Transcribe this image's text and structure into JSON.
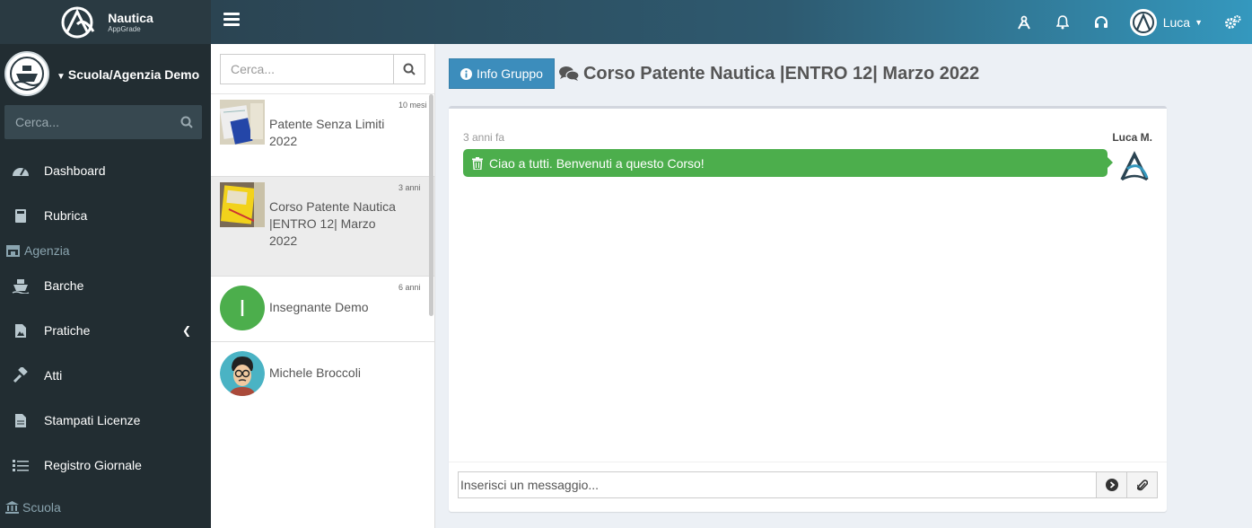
{
  "brand": {
    "name": "Nautica",
    "sub": "AppGrade"
  },
  "sidebar": {
    "user_name": "Scuola/Agenzia Demo",
    "search_placeholder": "Cerca...",
    "items": [
      {
        "label": "Dashboard",
        "icon": "dashboard-icon"
      },
      {
        "label": "Rubrica",
        "icon": "book-icon"
      },
      {
        "header": "Agenzia",
        "icon": "store-icon"
      },
      {
        "label": "Barche",
        "icon": "ship-icon"
      },
      {
        "label": "Pratiche",
        "icon": "file-image-icon",
        "has_submenu": true
      },
      {
        "label": "Atti",
        "icon": "gavel-icon"
      },
      {
        "label": "Stampati Licenze",
        "icon": "file-text-icon"
      },
      {
        "label": "Registro Giornale",
        "icon": "list-icon"
      },
      {
        "header": "Scuola",
        "icon": "institution-icon"
      }
    ]
  },
  "topbar": {
    "user_label": "Luca"
  },
  "chatlist": {
    "search_placeholder": "Cerca...",
    "conversations": [
      {
        "name": "Patente Senza Limiti 2022",
        "time": "10 mesi",
        "avatar": "photo"
      },
      {
        "name": "Corso Patente Nautica |ENTRO 12| Marzo 2022",
        "time": "3 anni",
        "avatar": "photo",
        "active": true
      },
      {
        "name": "Insegnante Demo",
        "time": "6 anni",
        "avatar": "letter",
        "letter": "I",
        "color": "#4cae4c"
      },
      {
        "name": "Michele Broccoli",
        "time": "",
        "avatar": "cartoon"
      }
    ]
  },
  "main": {
    "info_button": "Info Gruppo",
    "title": "Corso Patente Nautica |ENTRO 12| Marzo 2022",
    "message": {
      "time": "3 anni fa",
      "author": "Luca M.",
      "text": "Ciao a tutti. Benvenuti a questo Corso!"
    },
    "composer_placeholder": "Inserisci un messaggio..."
  },
  "colors": {
    "sidebar": "#222d32",
    "accent": "#3c8dbc",
    "bubble": "#4cae4c"
  }
}
